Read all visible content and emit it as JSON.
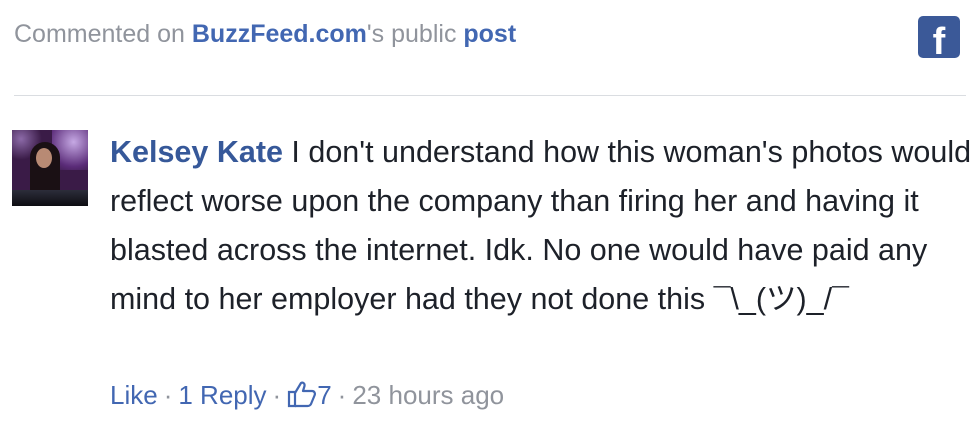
{
  "header": {
    "prefix": "Commented on ",
    "page_name": "BuzzFeed.com",
    "middle": "'s public ",
    "post_link": "post"
  },
  "badge": {
    "icon": "facebook-icon",
    "glyph": "f",
    "color": "#3b5998"
  },
  "comment": {
    "author": "Kelsey Kate",
    "text": "I don't understand how this woman's photos would reflect worse upon the company than firing her and having it blasted across the internet. Idk. No one would have paid any mind to her employer had they not done this ¯\\_(ツ)_/¯"
  },
  "actions": {
    "like": "Like",
    "separator": "·",
    "reply": "1 Reply",
    "like_count": "7",
    "timestamp": "23 hours ago"
  }
}
